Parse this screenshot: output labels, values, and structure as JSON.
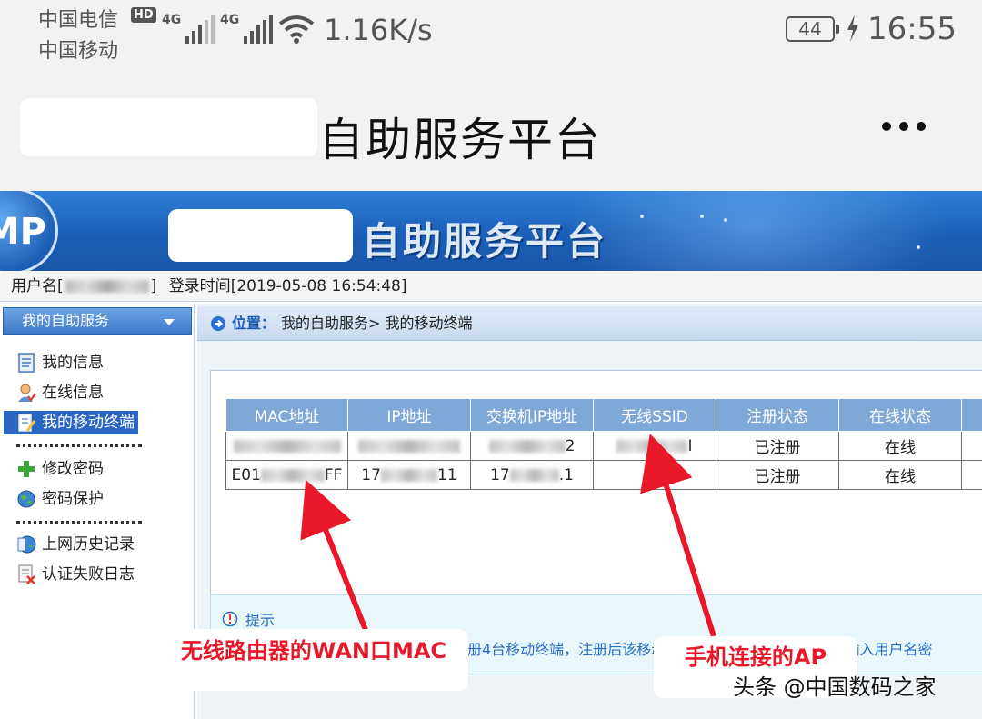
{
  "status_bar": {
    "carrier_primary": "中国电信",
    "hd_badge": "HD",
    "signal1_label": "4G",
    "signal2_label": "4G",
    "carrier_secondary": "中国移动",
    "net_speed": "1.16K/s",
    "battery": "44",
    "time": "16:55"
  },
  "app_bar": {
    "title": "自助服务平台"
  },
  "banner": {
    "logo_text": "MP",
    "title": "自助服务平台"
  },
  "user_bar": {
    "username_label": "用户名[",
    "username_close": "]",
    "login_time_label": "登录时间",
    "login_time": "[2019-05-08 16:54:48]"
  },
  "sidebar": {
    "header": "我的自助服务",
    "items": [
      {
        "label": "我的信息",
        "icon": "document-icon"
      },
      {
        "label": "在线信息",
        "icon": "user-online-icon"
      },
      {
        "label": "我的移动终端",
        "icon": "mobile-terminal-icon"
      },
      {
        "label": "修改密码",
        "icon": "plus-icon"
      },
      {
        "label": "密码保护",
        "icon": "globe-icon"
      },
      {
        "label": "上网历史记录",
        "icon": "history-icon"
      },
      {
        "label": "认证失败日志",
        "icon": "failure-log-icon"
      }
    ]
  },
  "breadcrumb": {
    "key": "位置：",
    "path": "我的自助服务> 我的移动终端"
  },
  "table": {
    "headers": [
      "MAC地址",
      "IP地址",
      "交换机IP地址",
      "无线SSID",
      "注册状态",
      "在线状态"
    ],
    "rows": [
      {
        "mac": "",
        "ip": "",
        "switch_ip_tail": "2",
        "ssid_tail": "I",
        "reg": "已注册",
        "online": "在线"
      },
      {
        "mac_prefix": "E01",
        "mac_suffix": "FF",
        "ip_prefix": "17",
        "ip_suffix": "11",
        "switch_prefix": "17",
        "switch_suffix": ".1",
        "ssid": "",
        "reg": "已注册",
        "online": "在线"
      }
    ]
  },
  "tip": {
    "title": "提示",
    "text": "您可以注册您的移动终端，最多允许注册4台移动终端，注册后该移动终端连接对应SSID将不需要输入用户名密"
  },
  "annotations": {
    "left_callout": "无线路由器的WAN口MAC",
    "right_callout": "手机连接的AP",
    "watermark": "头条 @中国数码之家",
    "color": "#e8182a"
  },
  "colors": {
    "banner_blue": "#1b5fb9",
    "table_header": "#7fa7d8",
    "active_nav": "#2a66c4"
  }
}
